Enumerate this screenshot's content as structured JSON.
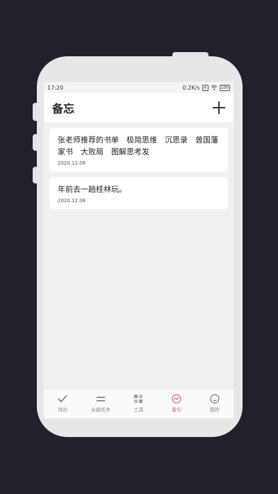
{
  "status_bar": {
    "time": "17:20",
    "speed": "0.2K/s",
    "battery": "100"
  },
  "header": {
    "title": "备忘"
  },
  "notes": [
    {
      "text": "张老师推荐的书单　极简思维　沉思录　曾国藩家书　大败局　图解思考发",
      "date": "2020.12.08"
    },
    {
      "text": "年前去一趟桂林玩。",
      "date": "2020.12.08"
    }
  ],
  "tabbar": {
    "tabs": [
      {
        "label": "待办",
        "icon": "check-icon"
      },
      {
        "label": "全部任务",
        "icon": "list-icon"
      },
      {
        "label": "工具",
        "icon": "grid-icon"
      },
      {
        "label": "备忘",
        "icon": "memo-icon"
      },
      {
        "label": "我的",
        "icon": "profile-icon"
      }
    ],
    "active_color": "#e0606a",
    "inactive_color": "#888888"
  }
}
